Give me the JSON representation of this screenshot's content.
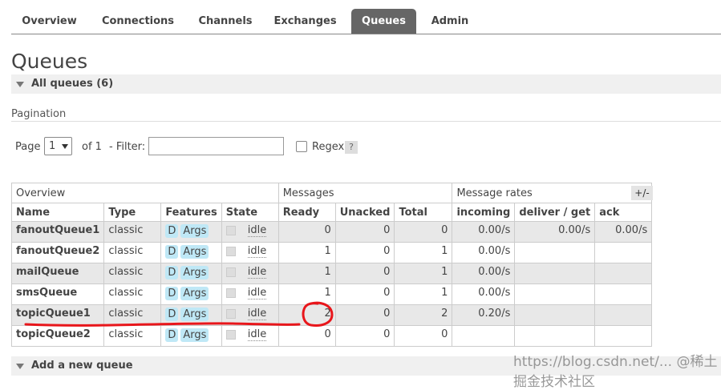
{
  "nav": {
    "tabs": [
      {
        "label": "Overview",
        "active": false
      },
      {
        "label": "Connections",
        "active": false
      },
      {
        "label": "Channels",
        "active": false
      },
      {
        "label": "Exchanges",
        "active": false
      },
      {
        "label": "Queues",
        "active": true
      },
      {
        "label": "Admin",
        "active": false
      }
    ]
  },
  "page": {
    "title": "Queues",
    "all_queues_label": "All queues (6)",
    "add_queue_label": "Add a new queue"
  },
  "pagination": {
    "heading": "Pagination",
    "page_label": "Page",
    "page_value": "1",
    "of_label": "of 1",
    "filter_label": "- Filter:",
    "filter_value": "",
    "regex_label": "Regex",
    "regex_checked": false,
    "help_label": "?"
  },
  "table": {
    "group_headers": {
      "overview": "Overview",
      "messages": "Messages",
      "message_rates": "Message rates"
    },
    "columns": {
      "name": "Name",
      "type": "Type",
      "features": "Features",
      "state": "State",
      "ready": "Ready",
      "unacked": "Unacked",
      "total": "Total",
      "incoming": "incoming",
      "deliver_get": "deliver / get",
      "ack": "ack"
    },
    "toggle_label": "+/-",
    "rows": [
      {
        "name": "fanoutQueue1",
        "type": "classic",
        "features": [
          "D",
          "Args"
        ],
        "state": "idle",
        "ready": "0",
        "unacked": "0",
        "total": "0",
        "incoming": "0.00/s",
        "deliver_get": "0.00/s",
        "ack": "0.00/s"
      },
      {
        "name": "fanoutQueue2",
        "type": "classic",
        "features": [
          "D",
          "Args"
        ],
        "state": "idle",
        "ready": "1",
        "unacked": "0",
        "total": "1",
        "incoming": "0.00/s",
        "deliver_get": "",
        "ack": ""
      },
      {
        "name": "mailQueue",
        "type": "classic",
        "features": [
          "D",
          "Args"
        ],
        "state": "idle",
        "ready": "1",
        "unacked": "0",
        "total": "1",
        "incoming": "0.00/s",
        "deliver_get": "",
        "ack": ""
      },
      {
        "name": "smsQueue",
        "type": "classic",
        "features": [
          "D",
          "Args"
        ],
        "state": "idle",
        "ready": "1",
        "unacked": "0",
        "total": "1",
        "incoming": "0.00/s",
        "deliver_get": "",
        "ack": ""
      },
      {
        "name": "topicQueue1",
        "type": "classic",
        "features": [
          "D",
          "Args"
        ],
        "state": "idle",
        "ready": "2",
        "unacked": "0",
        "total": "2",
        "incoming": "0.20/s",
        "deliver_get": "",
        "ack": ""
      },
      {
        "name": "topicQueue2",
        "type": "classic",
        "features": [
          "D",
          "Args"
        ],
        "state": "idle",
        "ready": "0",
        "unacked": "0",
        "total": "0",
        "incoming": "",
        "deliver_get": "",
        "ack": ""
      }
    ]
  },
  "annotation": {
    "color": "#e8161b"
  },
  "watermark": "https://blog.csdn.net/...  @稀土掘金技术社区"
}
